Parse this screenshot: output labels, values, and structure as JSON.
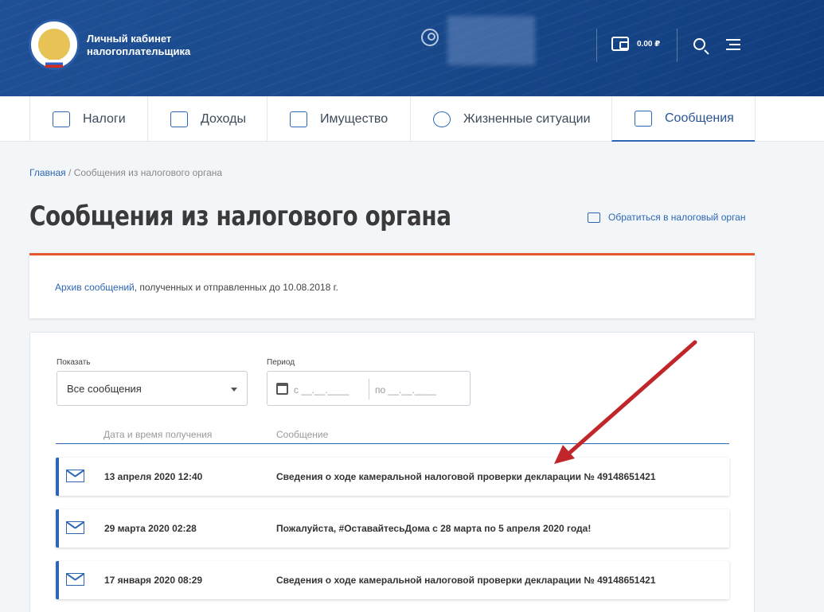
{
  "header": {
    "brand_line1": "Личный кабинет",
    "brand_line2": "налогоплательщика",
    "balance": "0.00 ₽"
  },
  "nav": [
    {
      "label": "Налоги",
      "icon": "calculator-icon"
    },
    {
      "label": "Доходы",
      "icon": "coins-icon"
    },
    {
      "label": "Имущество",
      "icon": "house-icon"
    },
    {
      "label": "Жизненные ситуации",
      "icon": "people-icon"
    },
    {
      "label": "Сообщения",
      "icon": "envelope-icon",
      "active": true
    }
  ],
  "breadcrumb": {
    "home": "Главная",
    "separator": " / ",
    "current": "Сообщения из налогового органа"
  },
  "page_title": "Сообщения из налогового органа",
  "contact_link": "Обратиться в налоговый орган",
  "archive": {
    "link": "Архив сообщений",
    "text": ", полученных и отправленных до 10.08.2018 г."
  },
  "filters": {
    "show_label": "Показать",
    "show_value": "Все сообщения",
    "period_label": "Период",
    "from_placeholder": "с __.__.____",
    "to_placeholder": "по __.__.____"
  },
  "table": {
    "col_date": "Дата и время получения",
    "col_message": "Сообщение",
    "rows": [
      {
        "date": "13 апреля 2020 12:40",
        "message": "Сведения о ходе камеральной налоговой проверки декларации № 49148651421"
      },
      {
        "date": "29 марта 2020 02:28",
        "message": "Пожалуйста, #ОставайтесьДома с 28 марта по 5 апреля 2020 года!"
      },
      {
        "date": "17 января 2020 08:29",
        "message": "Сведения о ходе камеральной налоговой проверки декларации № 49148651421"
      }
    ]
  },
  "colors": {
    "header": "#1a4a8c",
    "accent": "#2d66b5",
    "highlight": "#e4572e",
    "arrow": "#c0262a"
  }
}
